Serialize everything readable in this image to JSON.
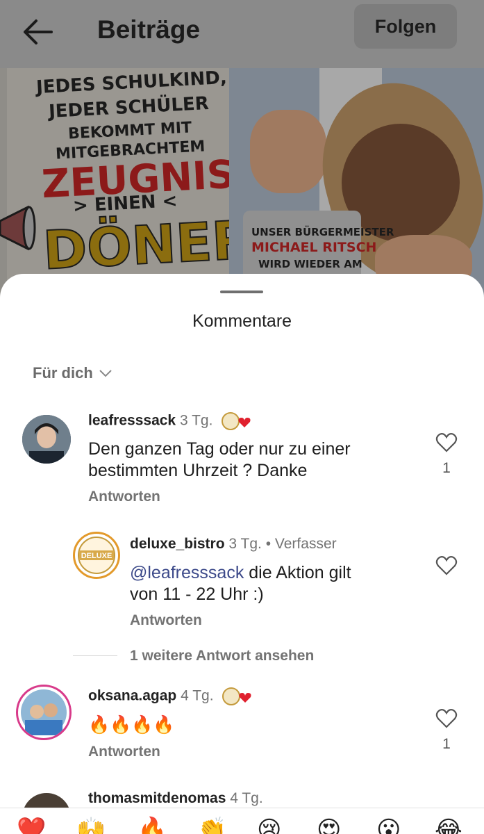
{
  "header": {
    "title": "Beiträge",
    "follow_label": "Folgen"
  },
  "post": {
    "lines": [
      "JEDES SCHULKIND,",
      "JEDER SCHÜLER",
      "BEKOMMT MIT",
      "MITGEBRACHTEM"
    ],
    "highlight": "ZEUGNIS",
    "einen": "> EINEN <",
    "doner": "DÖNER",
    "speech": [
      "UNSER BÜRGERMEISTER",
      "MICHAEL RITSCH",
      "WIRD WIEDER AM"
    ]
  },
  "sheet": {
    "title": "Kommentare",
    "filter": "Für dich"
  },
  "comments": [
    {
      "username": "leafresssack",
      "time": "3 Tg.",
      "text_line1": "Den ganzen Tag oder nur zu einer",
      "text_line2": "bestimmten Uhrzeit ? Danke",
      "reply_label": "Antworten",
      "likes": "1"
    },
    {
      "username": "deluxe_bistro",
      "time": "3 Tg.",
      "author_tag": "• Verfasser",
      "mention": "@leafresssack",
      "text_rest": " die Aktion gilt",
      "text_line2": "von 11 - 22 Uhr :)",
      "reply_label": "Antworten",
      "avatar_text": "DELUXE"
    },
    {
      "username": "oksana.agap",
      "time": "4 Tg.",
      "text": "🔥🔥🔥🔥",
      "reply_label": "Antworten",
      "likes": "1"
    },
    {
      "username": "thomasmitdenomas",
      "time": "4 Tg."
    }
  ],
  "more_replies": "1 weitere Antwort ansehen",
  "emoji_bar": [
    "❤️",
    "🙌",
    "🔥",
    "👏",
    "😢",
    "😍",
    "😮",
    "😂"
  ]
}
